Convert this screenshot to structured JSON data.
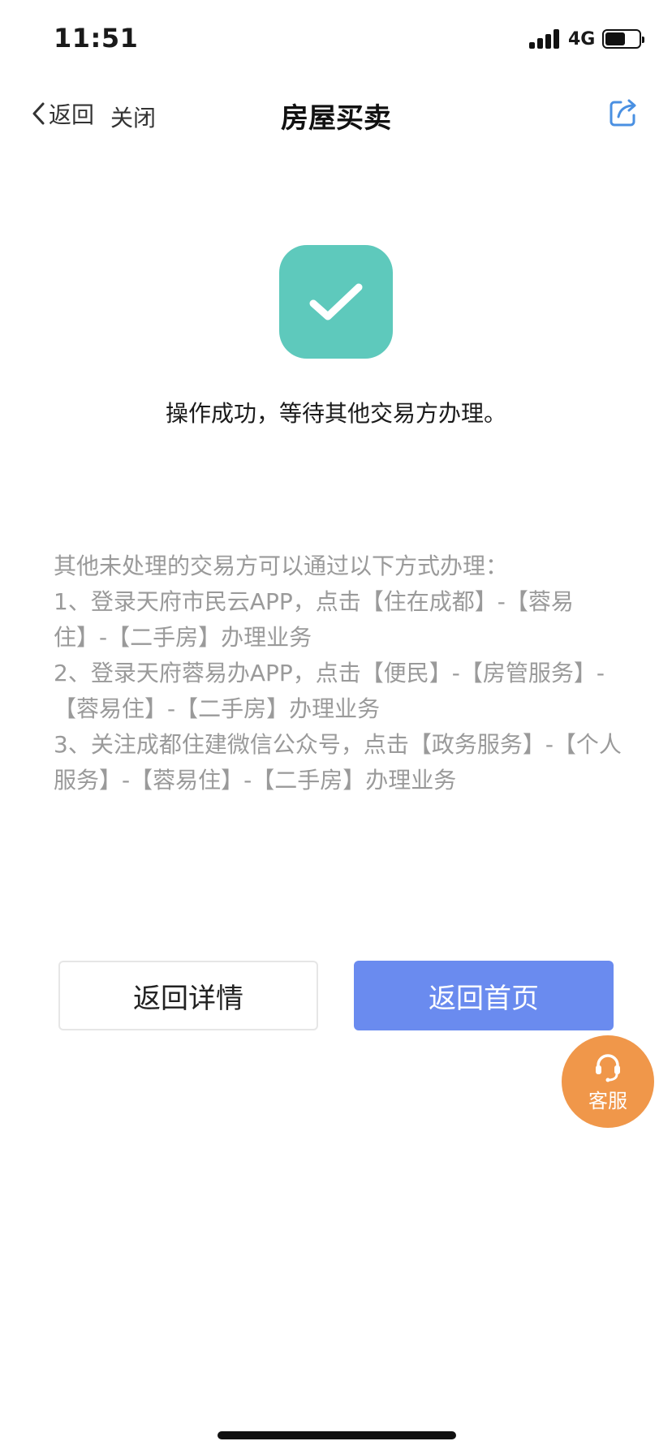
{
  "status_bar": {
    "time": "11:51",
    "network": "4G",
    "battery_level": 0.6
  },
  "nav": {
    "back_label": "返回",
    "close_label": "关闭",
    "title": "房屋买卖",
    "icons": {
      "back": "chevron-left-icon",
      "share": "share-icon"
    }
  },
  "success": {
    "icon": "check-icon",
    "icon_color": "#5ec9bc",
    "message": "操作成功，等待其他交易方办理。"
  },
  "instructions": {
    "lines": [
      "其他未处理的交易方可以通过以下方式办理：",
      "1、登录天府市民云APP，点击【住在成都】-【蓉易住】-【二手房】办理业务",
      "2、登录天府蓉易办APP，点击【便民】-【房管服务】-【蓉易住】-【二手房】办理业务",
      "3、关注成都住建微信公众号，点击【政务服务】-【个人服务】-【蓉易住】-【二手房】办理业务"
    ]
  },
  "actions": {
    "detail_label": "返回详情",
    "home_label": "返回首页",
    "home_color": "#6a8bef"
  },
  "service": {
    "label": "客服",
    "icon": "headset-icon",
    "color": "#f0974a"
  }
}
